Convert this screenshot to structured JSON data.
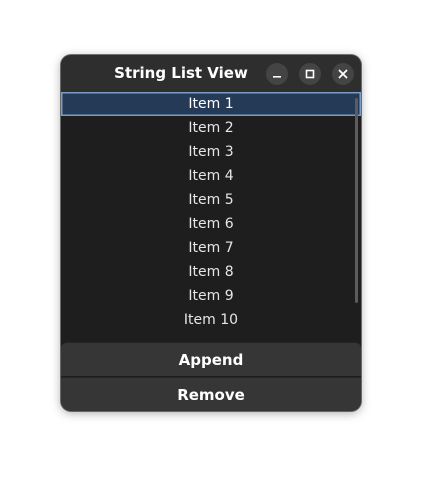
{
  "window": {
    "title": "String List View"
  },
  "list": {
    "items": [
      "Item 1",
      "Item 2",
      "Item 3",
      "Item 4",
      "Item 5",
      "Item 6",
      "Item 7",
      "Item 8",
      "Item 9",
      "Item 10"
    ],
    "selected_index": 0
  },
  "actions": {
    "append_label": "Append",
    "remove_label": "Remove"
  },
  "icons": {
    "minimize": "minimize-icon",
    "maximize": "maximize-icon",
    "close": "close-icon"
  },
  "colors": {
    "selection_bg": "#243a57",
    "selection_border": "#7b9cc4",
    "window_bg": "#1e1e1e",
    "button_bg": "#363636"
  }
}
